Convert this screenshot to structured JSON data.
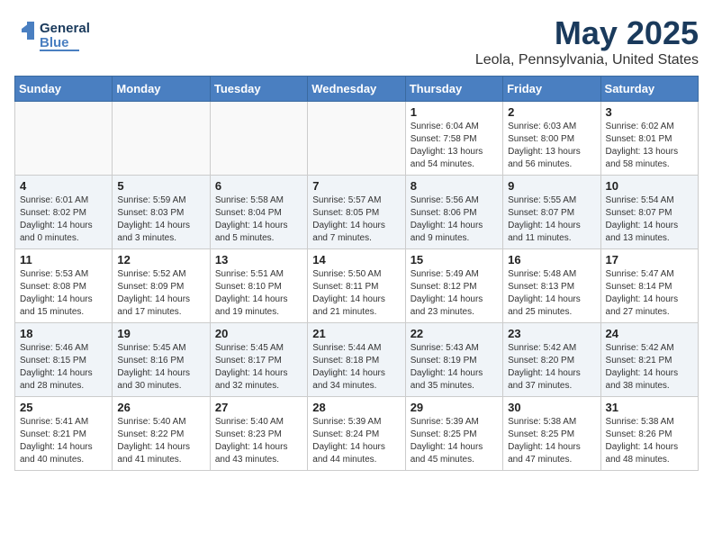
{
  "header": {
    "logo_line1": "General",
    "logo_line2": "Blue",
    "title": "May 2025",
    "subtitle": "Leola, Pennsylvania, United States"
  },
  "calendar": {
    "days_of_week": [
      "Sunday",
      "Monday",
      "Tuesday",
      "Wednesday",
      "Thursday",
      "Friday",
      "Saturday"
    ],
    "weeks": [
      [
        {
          "day": "",
          "info": ""
        },
        {
          "day": "",
          "info": ""
        },
        {
          "day": "",
          "info": ""
        },
        {
          "day": "",
          "info": ""
        },
        {
          "day": "1",
          "info": "Sunrise: 6:04 AM\nSunset: 7:58 PM\nDaylight: 13 hours\nand 54 minutes."
        },
        {
          "day": "2",
          "info": "Sunrise: 6:03 AM\nSunset: 8:00 PM\nDaylight: 13 hours\nand 56 minutes."
        },
        {
          "day": "3",
          "info": "Sunrise: 6:02 AM\nSunset: 8:01 PM\nDaylight: 13 hours\nand 58 minutes."
        }
      ],
      [
        {
          "day": "4",
          "info": "Sunrise: 6:01 AM\nSunset: 8:02 PM\nDaylight: 14 hours\nand 0 minutes."
        },
        {
          "day": "5",
          "info": "Sunrise: 5:59 AM\nSunset: 8:03 PM\nDaylight: 14 hours\nand 3 minutes."
        },
        {
          "day": "6",
          "info": "Sunrise: 5:58 AM\nSunset: 8:04 PM\nDaylight: 14 hours\nand 5 minutes."
        },
        {
          "day": "7",
          "info": "Sunrise: 5:57 AM\nSunset: 8:05 PM\nDaylight: 14 hours\nand 7 minutes."
        },
        {
          "day": "8",
          "info": "Sunrise: 5:56 AM\nSunset: 8:06 PM\nDaylight: 14 hours\nand 9 minutes."
        },
        {
          "day": "9",
          "info": "Sunrise: 5:55 AM\nSunset: 8:07 PM\nDaylight: 14 hours\nand 11 minutes."
        },
        {
          "day": "10",
          "info": "Sunrise: 5:54 AM\nSunset: 8:07 PM\nDaylight: 14 hours\nand 13 minutes."
        }
      ],
      [
        {
          "day": "11",
          "info": "Sunrise: 5:53 AM\nSunset: 8:08 PM\nDaylight: 14 hours\nand 15 minutes."
        },
        {
          "day": "12",
          "info": "Sunrise: 5:52 AM\nSunset: 8:09 PM\nDaylight: 14 hours\nand 17 minutes."
        },
        {
          "day": "13",
          "info": "Sunrise: 5:51 AM\nSunset: 8:10 PM\nDaylight: 14 hours\nand 19 minutes."
        },
        {
          "day": "14",
          "info": "Sunrise: 5:50 AM\nSunset: 8:11 PM\nDaylight: 14 hours\nand 21 minutes."
        },
        {
          "day": "15",
          "info": "Sunrise: 5:49 AM\nSunset: 8:12 PM\nDaylight: 14 hours\nand 23 minutes."
        },
        {
          "day": "16",
          "info": "Sunrise: 5:48 AM\nSunset: 8:13 PM\nDaylight: 14 hours\nand 25 minutes."
        },
        {
          "day": "17",
          "info": "Sunrise: 5:47 AM\nSunset: 8:14 PM\nDaylight: 14 hours\nand 27 minutes."
        }
      ],
      [
        {
          "day": "18",
          "info": "Sunrise: 5:46 AM\nSunset: 8:15 PM\nDaylight: 14 hours\nand 28 minutes."
        },
        {
          "day": "19",
          "info": "Sunrise: 5:45 AM\nSunset: 8:16 PM\nDaylight: 14 hours\nand 30 minutes."
        },
        {
          "day": "20",
          "info": "Sunrise: 5:45 AM\nSunset: 8:17 PM\nDaylight: 14 hours\nand 32 minutes."
        },
        {
          "day": "21",
          "info": "Sunrise: 5:44 AM\nSunset: 8:18 PM\nDaylight: 14 hours\nand 34 minutes."
        },
        {
          "day": "22",
          "info": "Sunrise: 5:43 AM\nSunset: 8:19 PM\nDaylight: 14 hours\nand 35 minutes."
        },
        {
          "day": "23",
          "info": "Sunrise: 5:42 AM\nSunset: 8:20 PM\nDaylight: 14 hours\nand 37 minutes."
        },
        {
          "day": "24",
          "info": "Sunrise: 5:42 AM\nSunset: 8:21 PM\nDaylight: 14 hours\nand 38 minutes."
        }
      ],
      [
        {
          "day": "25",
          "info": "Sunrise: 5:41 AM\nSunset: 8:21 PM\nDaylight: 14 hours\nand 40 minutes."
        },
        {
          "day": "26",
          "info": "Sunrise: 5:40 AM\nSunset: 8:22 PM\nDaylight: 14 hours\nand 41 minutes."
        },
        {
          "day": "27",
          "info": "Sunrise: 5:40 AM\nSunset: 8:23 PM\nDaylight: 14 hours\nand 43 minutes."
        },
        {
          "day": "28",
          "info": "Sunrise: 5:39 AM\nSunset: 8:24 PM\nDaylight: 14 hours\nand 44 minutes."
        },
        {
          "day": "29",
          "info": "Sunrise: 5:39 AM\nSunset: 8:25 PM\nDaylight: 14 hours\nand 45 minutes."
        },
        {
          "day": "30",
          "info": "Sunrise: 5:38 AM\nSunset: 8:25 PM\nDaylight: 14 hours\nand 47 minutes."
        },
        {
          "day": "31",
          "info": "Sunrise: 5:38 AM\nSunset: 8:26 PM\nDaylight: 14 hours\nand 48 minutes."
        }
      ]
    ]
  }
}
